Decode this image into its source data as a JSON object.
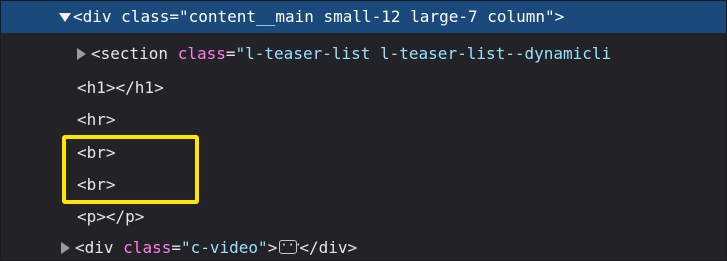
{
  "inspector": {
    "nodes": [
      {
        "expanded": true,
        "selected": true,
        "open": "<div",
        "attr_name": "class",
        "eq": "=",
        "attr_value": "\"content__main small-12 large-7 column\"",
        "close": ">"
      },
      {
        "collapsed": true,
        "open": "<section",
        "attr_name": "class",
        "eq": "=",
        "attr_value": "\"l-teaser-list l-teaser-list--dynamicli"
      },
      {
        "text": "<h1></h1>"
      },
      {
        "text": "<hr>"
      },
      {
        "text": "<br>"
      },
      {
        "text": "<br>"
      },
      {
        "text": "<p></p>"
      },
      {
        "collapsed": true,
        "open": "<div",
        "attr_name": "class",
        "eq": "=",
        "attr_value": "\"c-video\"",
        "close": ">",
        "ellipsis": "···",
        "end": "</div>"
      }
    ]
  },
  "annotation": {
    "color": "#ffe600"
  }
}
